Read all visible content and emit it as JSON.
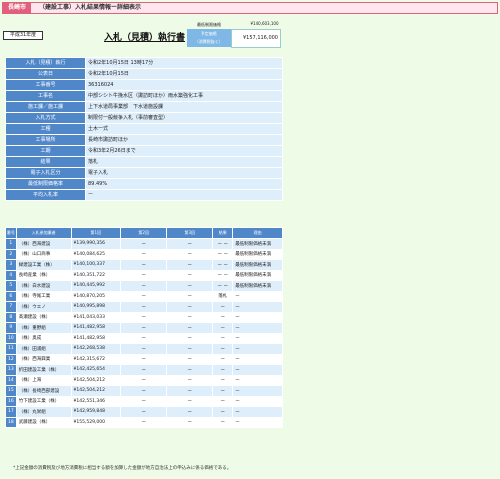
{
  "header": {
    "city": "長崎市",
    "title": "（建設工事）入札結果情報ー詳細表示"
  },
  "era": "平成31年度",
  "doc_title": "入札（見積）執行書",
  "prices": {
    "min_label": "最低制限価格",
    "min_value": "¥140,603,100",
    "est_label": "予定価格\n（消費税抜く）",
    "est_value": "¥157,116,000"
  },
  "info": [
    {
      "k": "入札（見積）執行",
      "v": "令和2年10月15日 13時17分"
    },
    {
      "k": "公表日",
      "v": "令和2年10月15日"
    },
    {
      "k": "工事番号",
      "v": "36316024"
    },
    {
      "k": "工事名",
      "v": "中部シシト牛挽水区（諏訪町ほか）雨水築強化工事"
    },
    {
      "k": "施工課／施工課",
      "v": "上下水道局事業部　下水道施設課"
    },
    {
      "k": "入札方式",
      "v": "制限付一般競争入札（事前審査型）"
    },
    {
      "k": "工種",
      "v": "土木一式"
    },
    {
      "k": "工事場所",
      "v": "長崎市諏訪町ほか"
    },
    {
      "k": "工期",
      "v": "令和3年2月26日まで"
    },
    {
      "k": "結果",
      "v": "落札"
    },
    {
      "k": "電子入札区分",
      "v": "電子入札"
    },
    {
      "k": "最低制限価格率",
      "v": "89.49%"
    },
    {
      "k": "平均入札率",
      "v": "ー"
    }
  ],
  "bid_headers": {
    "no": "番号",
    "name": "入札参加業者",
    "r1": "第1回",
    "r2": "第2回",
    "r3": "第3回",
    "res": "結果",
    "reason": "理由"
  },
  "bids": [
    {
      "no": "1",
      "name": "（株）西海建設",
      "r1": "¥139,990,356",
      "r2": "ー",
      "r3": "ー",
      "res": "ー ー",
      "reason": "最低制限価格未満"
    },
    {
      "no": "2",
      "name": "（株）山口商事",
      "r1": "¥140,084,625",
      "r2": "ー",
      "r3": "ー",
      "res": "ー ー",
      "reason": "最低制限価格未満"
    },
    {
      "no": "3",
      "name": "緑建設工業（株）",
      "r1": "¥140,100,337",
      "r2": "ー",
      "r3": "ー",
      "res": "ー ー",
      "reason": "最低制限価格未満"
    },
    {
      "no": "4",
      "name": "長崎産業（株）",
      "r1": "¥140,351,722",
      "r2": "ー",
      "r3": "ー",
      "res": "ー ー",
      "reason": "最低制限価格未満"
    },
    {
      "no": "5",
      "name": "（株）白水建設",
      "r1": "¥140,445,992",
      "r2": "ー",
      "r3": "ー",
      "res": "ー ー",
      "reason": "最低制限価格未満"
    },
    {
      "no": "6",
      "name": "（株）寺尾工業",
      "r1": "¥140,870,205",
      "r2": "ー",
      "r3": "ー",
      "res": "落札",
      "reason": "ー"
    },
    {
      "no": "7",
      "name": "（株）ウエノ",
      "r1": "¥140,995,898",
      "r2": "ー",
      "r3": "ー",
      "res": "ー",
      "reason": "ー"
    },
    {
      "no": "8",
      "name": "髙瀬建設（株）",
      "r1": "¥141,043,033",
      "r2": "ー",
      "r3": "ー",
      "res": "ー",
      "reason": "ー"
    },
    {
      "no": "9",
      "name": "（株）重野組",
      "r1": "¥141,482,958",
      "r2": "ー",
      "r3": "ー",
      "res": "ー",
      "reason": "ー"
    },
    {
      "no": "10",
      "name": "（株）奥成",
      "r1": "¥141,482,958",
      "r2": "ー",
      "r3": "ー",
      "res": "ー",
      "reason": "ー"
    },
    {
      "no": "11",
      "name": "（株）田浦組",
      "r1": "¥142,268,538",
      "r2": "ー",
      "r3": "ー",
      "res": "ー",
      "reason": "ー"
    },
    {
      "no": "12",
      "name": "（株）西海興業",
      "r1": "¥142,315,672",
      "r2": "ー",
      "r3": "ー",
      "res": "ー",
      "reason": "ー"
    },
    {
      "no": "13",
      "name": "折田建設工業（株）",
      "r1": "¥142,425,654",
      "r2": "ー",
      "r3": "ー",
      "res": "ー",
      "reason": "ー"
    },
    {
      "no": "14",
      "name": "（株）上海",
      "r1": "¥142,504,212",
      "r2": "ー",
      "r3": "ー",
      "res": "ー",
      "reason": "ー"
    },
    {
      "no": "15",
      "name": "（株）長崎西部建設",
      "r1": "¥142,504,212",
      "r2": "ー",
      "r3": "ー",
      "res": "ー",
      "reason": "ー"
    },
    {
      "no": "16",
      "name": "竹下建設工業（株）",
      "r1": "¥142,551,346",
      "r2": "ー",
      "r3": "ー",
      "res": "ー",
      "reason": "ー"
    },
    {
      "no": "17",
      "name": "（株）丸栄組",
      "r1": "¥142,959,848",
      "r2": "ー",
      "r3": "ー",
      "res": "ー",
      "reason": "ー"
    },
    {
      "no": "18",
      "name": "武藤建設（株）",
      "r1": "¥155,529,000",
      "r2": "ー",
      "r3": "ー",
      "res": "ー",
      "reason": "ー"
    }
  ],
  "note": "*上記金額の消費税及び地方消費税に相当する額を加算した金額が地方自治法上の申込みに係る価格である。"
}
